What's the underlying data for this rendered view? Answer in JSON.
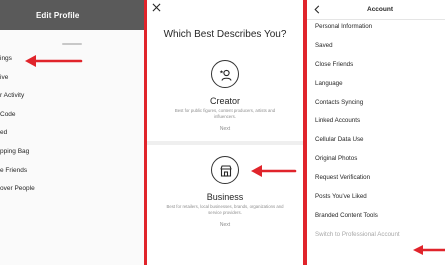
{
  "colors": {
    "accent": "#e0242b",
    "header": "#5a5a5a",
    "muted": "#8e8e8e"
  },
  "panel1": {
    "title": "Edit Profile",
    "items": [
      {
        "label": "ings"
      },
      {
        "label": "ive"
      },
      {
        "label": "r Activity"
      },
      {
        "label": "Code"
      },
      {
        "label": "ed"
      },
      {
        "label": "pping Bag"
      },
      {
        "label": "e Friends"
      },
      {
        "label": "over People"
      }
    ]
  },
  "panel2": {
    "close_icon": "close-icon",
    "title": "Which Best Describes You?",
    "creator": {
      "icon": "creator-icon",
      "name": "Creator",
      "description": "Best for public figures, content producers, artists and influencers.",
      "next": "Next"
    },
    "business": {
      "icon": "storefront-icon",
      "name": "Business",
      "description": "Best for retailers, local businesses, brands, organizations and service providers.",
      "next": "Next"
    }
  },
  "panel3": {
    "back_icon": "chevron-left-icon",
    "title": "Account",
    "items": [
      {
        "label": "Personal Information"
      },
      {
        "label": "Saved"
      },
      {
        "label": "Close Friends"
      },
      {
        "label": "Language"
      },
      {
        "label": "Contacts Syncing"
      },
      {
        "label": "Linked Accounts"
      },
      {
        "label": "Cellular Data Use"
      },
      {
        "label": "Original Photos"
      },
      {
        "label": "Request Verification"
      },
      {
        "label": "Posts You've Liked"
      },
      {
        "label": "Branded Content Tools"
      },
      {
        "label": "Switch to Professional Account",
        "muted": true
      }
    ]
  }
}
